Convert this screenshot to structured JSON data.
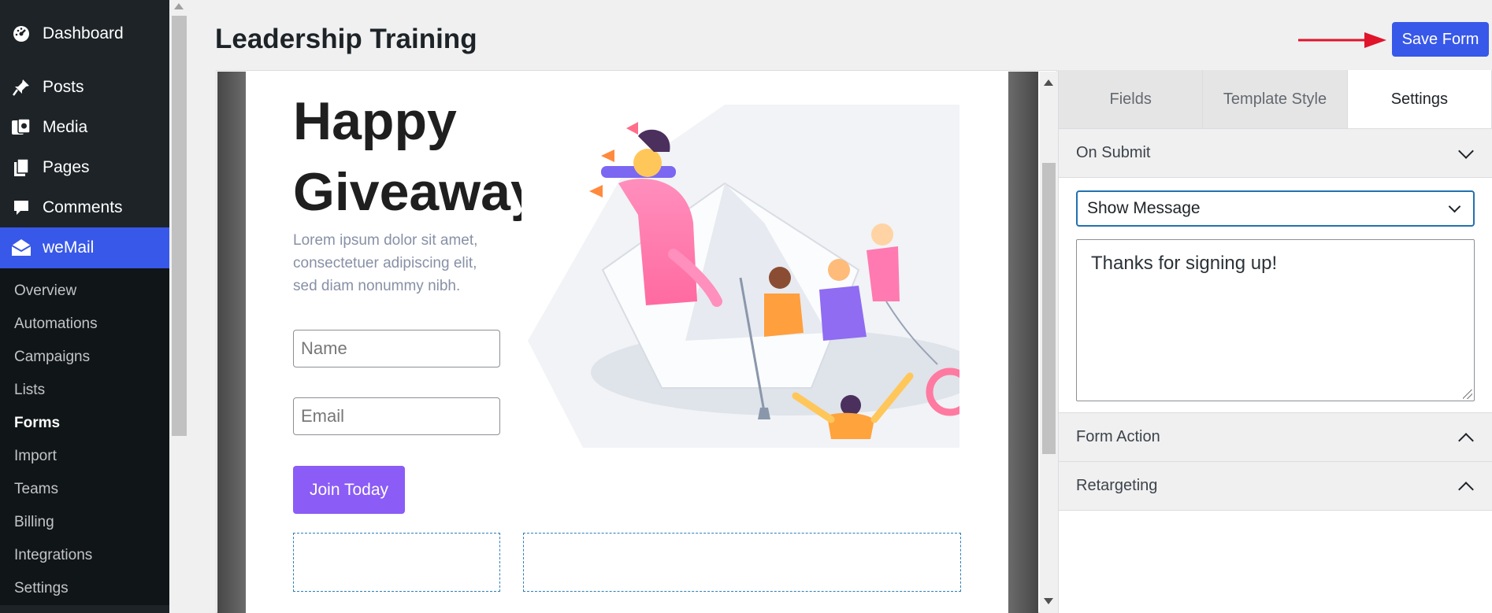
{
  "sidebar": {
    "top_items": [
      {
        "label": "Dashboard",
        "icon": "dashboard-icon"
      },
      {
        "label": "Posts",
        "icon": "pin-icon"
      },
      {
        "label": "Media",
        "icon": "media-icon"
      },
      {
        "label": "Pages",
        "icon": "pages-icon"
      },
      {
        "label": "Comments",
        "icon": "comment-icon"
      },
      {
        "label": "weMail",
        "icon": "mail-icon"
      }
    ],
    "sub_items": [
      "Overview",
      "Automations",
      "Campaigns",
      "Lists",
      "Forms",
      "Import",
      "Teams",
      "Billing",
      "Integrations",
      "Settings"
    ],
    "current_sub": "Forms"
  },
  "header": {
    "title": "Leadership Training",
    "save_label": "Save Form"
  },
  "form_preview": {
    "headline_line1": "Happy",
    "headline_line2": "Giveaway",
    "description": "Lorem ipsum dolor sit amet, consectetuer adipiscing elit, sed diam nonummy nibh.",
    "name_placeholder": "Name",
    "email_placeholder": "Email",
    "button_label": "Join Today"
  },
  "panel": {
    "tabs": [
      "Fields",
      "Template Style",
      "Settings"
    ],
    "active_tab": "Settings",
    "on_submit": {
      "title": "On Submit",
      "action_selected": "Show Message",
      "message": "Thanks for signing up!"
    },
    "form_action_title": "Form Action",
    "retargeting_title": "Retargeting"
  },
  "colors": {
    "accent": "#3858e9",
    "sidebar_bg": "#1d2327",
    "join_button": "#8b5cf6",
    "annotation_arrow": "#e0142a"
  }
}
